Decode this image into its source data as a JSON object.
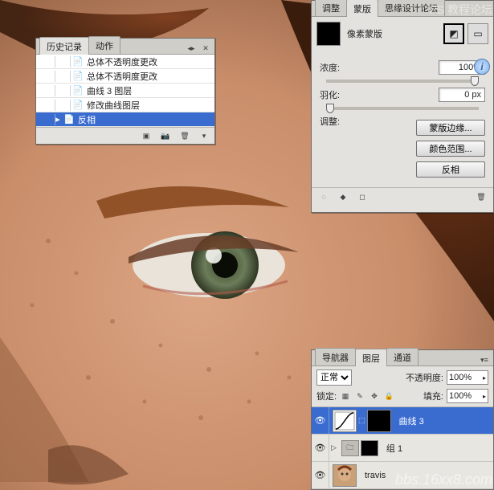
{
  "watermark_top": "PS 教程论坛",
  "watermark_bottom": "bbs.16xx8.com",
  "history": {
    "tabs": [
      "历史记录",
      "动作"
    ],
    "active_tab": 0,
    "items": [
      {
        "label": "总体不透明度更改"
      },
      {
        "label": "总体不透明度更改"
      },
      {
        "label": "曲线 3 图层"
      },
      {
        "label": "修改曲线图层"
      },
      {
        "label": "反相",
        "selected": true
      }
    ]
  },
  "mask": {
    "tabs": [
      "调整",
      "蒙版",
      "思缘设计论坛"
    ],
    "active_tab": 1,
    "title": "像素蒙版",
    "density_label": "浓度:",
    "density_value": "100%",
    "feather_label": "羽化:",
    "feather_value": "0 px",
    "adjust_label": "调整:",
    "buttons": {
      "edge": "蒙版边缘...",
      "color_range": "颜色范围...",
      "invert": "反相"
    }
  },
  "layers": {
    "tabs": [
      "导航器",
      "图层",
      "通道"
    ],
    "active_tab": 1,
    "blend_mode": "正常",
    "opacity_label": "不透明度:",
    "opacity_value": "100%",
    "lock_label": "锁定:",
    "fill_label": "填充:",
    "fill_value": "100%",
    "items": [
      {
        "name": "曲线 3",
        "selected": true,
        "type": "curves"
      },
      {
        "name": "组 1",
        "type": "group"
      },
      {
        "name": "travis",
        "type": "image"
      }
    ]
  }
}
